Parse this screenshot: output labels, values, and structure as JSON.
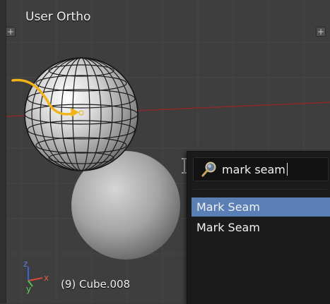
{
  "viewport": {
    "title": "User Ortho",
    "object_label": "(9) Cube.008"
  },
  "axes": {
    "x": "x",
    "y": "y",
    "z": "z"
  },
  "colors": {
    "menu_highlight": "#5a7fb5",
    "annotation_arrow": "#f2b31a"
  },
  "search": {
    "value": "mark seam"
  },
  "menu": {
    "items": [
      {
        "label": "Mark Seam",
        "active": true
      },
      {
        "label": "Mark Seam",
        "active": false
      }
    ]
  }
}
